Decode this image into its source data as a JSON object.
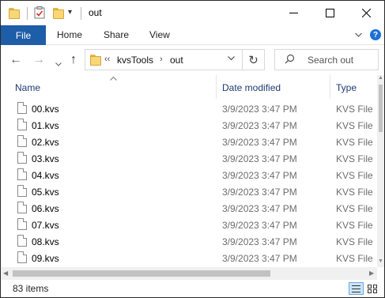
{
  "window": {
    "title": "out",
    "minimize_label": "—",
    "maximize_label": "☐",
    "close_label": "✕"
  },
  "quick_access": {
    "dropdown_glyph": "▾"
  },
  "ribbon": {
    "tabs": [
      {
        "label": "File"
      },
      {
        "label": "Home"
      },
      {
        "label": "Share"
      },
      {
        "label": "View"
      }
    ],
    "collapse_glyph": "⌄",
    "help_label": "?"
  },
  "navigation": {
    "back_glyph": "←",
    "forward_glyph": "→",
    "recent_glyph": "⌄",
    "up_glyph": "↑"
  },
  "address": {
    "overflow": "‹‹",
    "breadcrumbs": [
      "kvsTools",
      "out"
    ],
    "separator": "›",
    "dropdown_glyph": "⌄",
    "refresh_glyph": "↻"
  },
  "search": {
    "placeholder": "Search out",
    "icon": "search-icon"
  },
  "columns": {
    "name": "Name",
    "date": "Date modified",
    "type": "Type",
    "sort_glyph": "⌃"
  },
  "files": [
    {
      "name": "00.kvs",
      "date": "3/9/2023 3:47 PM",
      "type": "KVS File"
    },
    {
      "name": "01.kvs",
      "date": "3/9/2023 3:47 PM",
      "type": "KVS File"
    },
    {
      "name": "02.kvs",
      "date": "3/9/2023 3:47 PM",
      "type": "KVS File"
    },
    {
      "name": "03.kvs",
      "date": "3/9/2023 3:47 PM",
      "type": "KVS File"
    },
    {
      "name": "04.kvs",
      "date": "3/9/2023 3:47 PM",
      "type": "KVS File"
    },
    {
      "name": "05.kvs",
      "date": "3/9/2023 3:47 PM",
      "type": "KVS File"
    },
    {
      "name": "06.kvs",
      "date": "3/9/2023 3:47 PM",
      "type": "KVS File"
    },
    {
      "name": "07.kvs",
      "date": "3/9/2023 3:47 PM",
      "type": "KVS File"
    },
    {
      "name": "08.kvs",
      "date": "3/9/2023 3:47 PM",
      "type": "KVS File"
    },
    {
      "name": "09.kvs",
      "date": "3/9/2023 3:47 PM",
      "type": "KVS File"
    }
  ],
  "status": {
    "item_count": "83 items"
  },
  "colors": {
    "file_tab": "#1e5da8",
    "header_text": "#1d3a75",
    "secondary_text": "#6d6d6d",
    "folder_yellow": "#f8d775"
  }
}
